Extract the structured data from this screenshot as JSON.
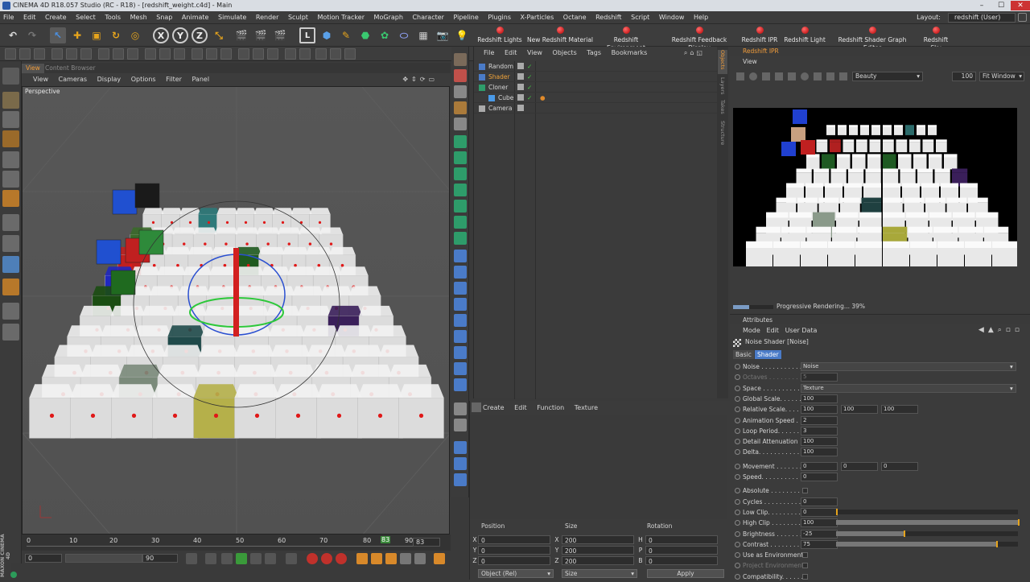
{
  "window": {
    "title": "CINEMA 4D R18.057 Studio (RC - R18) - [redshift_weight.c4d] - Main"
  },
  "menu": [
    "File",
    "Edit",
    "Create",
    "Select",
    "Tools",
    "Mesh",
    "Snap",
    "Animate",
    "Simulate",
    "Render",
    "Sculpt",
    "Motion Tracker",
    "MoGraph",
    "Character",
    "Pipeline",
    "Plugins",
    "X-Particles",
    "Octane",
    "Redshift",
    "Script",
    "Window",
    "Help"
  ],
  "layout": {
    "label": "Layout:",
    "value": "redshift (User)"
  },
  "toolbar": {
    "x_label": "X",
    "y_label": "Y",
    "z_label": "Z"
  },
  "redshift_toolbar": [
    "Redshift Lights",
    "New Redshift Material",
    "Redshift Environment",
    "Redshift Feedback Display",
    "Redshift IPR",
    "Redshift Light",
    "Redshift Shader Graph Editor",
    "Redshift Sky"
  ],
  "viewport": {
    "tabs": [
      "View",
      "Content Browser"
    ],
    "menu": [
      "View",
      "Cameras",
      "Display",
      "Options",
      "Filter",
      "Panel"
    ],
    "label": "Perspective"
  },
  "timeline": {
    "ticks": [
      "0",
      "10",
      "20",
      "30",
      "40",
      "50",
      "60",
      "70",
      "80",
      "83",
      "90"
    ],
    "current_frame": "83",
    "start": "0",
    "end": "90"
  },
  "objects": {
    "menu": [
      "File",
      "Edit",
      "View",
      "Objects",
      "Tags",
      "Bookmarks"
    ],
    "items": [
      {
        "name": "Random",
        "color": "#d6d6d6",
        "indent": 0
      },
      {
        "name": "Shader",
        "color": "#f0a33a",
        "indent": 0
      },
      {
        "name": "Cloner",
        "color": "#d6d6d6",
        "indent": 0
      },
      {
        "name": "Cube",
        "color": "#d6d6d6",
        "indent": 1
      },
      {
        "name": "Camera",
        "color": "#d6d6d6",
        "indent": 0
      }
    ]
  },
  "side_tabs": [
    "Objects",
    "Layers",
    "Takes",
    "Structure"
  ],
  "ipr": {
    "title": "Redshift IPR",
    "view": "View",
    "aov": "Beauty",
    "zoom": "100",
    "fit": "Fit Window",
    "progress_text": "Progressive Rendering... 39%",
    "progress": 0.39
  },
  "attributes": {
    "title": "Attributes",
    "menu": [
      "Mode",
      "Edit",
      "User Data"
    ],
    "object": "Noise Shader [Noise]",
    "tabs": [
      "Basic",
      "Shader"
    ],
    "rows": [
      {
        "label": "Noise . . . . . . . . . . . . .",
        "value": "Noise",
        "wide": true
      },
      {
        "label": "Octaves . . . . . . . . . . .",
        "value": "5",
        "dim": true
      },
      {
        "label": "Space . . . . . . . . . . . . .",
        "value": "Texture",
        "wide": true
      },
      {
        "label": "Global Scale. . . . . . .",
        "value": "100"
      },
      {
        "label": "Relative Scale. . . . . .",
        "value": "100",
        "v2": "100",
        "v3": "100"
      },
      {
        "label": "Animation Speed . .",
        "value": "2"
      },
      {
        "label": "Loop Period. . . . . . .",
        "value": "3"
      },
      {
        "label": "Detail Attenuation",
        "value": "100"
      },
      {
        "label": "Delta. . . . . . . . . . . . . .",
        "value": "100"
      },
      {
        "label": "",
        "value": ""
      },
      {
        "label": "Movement . . . . . . . .",
        "value": "0",
        "v2": "0",
        "v3": "0"
      },
      {
        "label": "Speed. . . . . . . . . . . . .",
        "value": "0"
      },
      {
        "label": "",
        "value": ""
      },
      {
        "label": "Absolute . . . . . . . . . .",
        "value": "",
        "check": true
      },
      {
        "label": "Cycles . . . . . . . . . . . .",
        "value": "0"
      },
      {
        "label": "Low Clip. . . . . . . . . . .",
        "value": "0",
        "slider": 0.0
      },
      {
        "label": "High Clip . . . . . . . . . .",
        "value": "100",
        "slider": 1.0
      },
      {
        "label": "Brightness . . . . . . . .",
        "value": "-25",
        "slider": 0.37
      },
      {
        "label": "Contrast . . . . . . . . . .",
        "value": "75",
        "slider": 0.88
      },
      {
        "label": "Use as Environment",
        "value": "",
        "check": true
      },
      {
        "label": "Project Environment",
        "value": "",
        "check": true,
        "dim": true
      },
      {
        "label": "Compatibility. . . . . . .",
        "value": "",
        "check": true
      }
    ]
  },
  "coords": {
    "menu": [
      "Create",
      "Edit",
      "Function",
      "Texture"
    ],
    "headers": [
      "Position",
      "Size",
      "Rotation"
    ],
    "rows": [
      {
        "a": "X",
        "p": "0",
        "b": "X",
        "s": "200",
        "c": "H",
        "r": "0"
      },
      {
        "a": "Y",
        "p": "0",
        "b": "Y",
        "s": "200",
        "c": "P",
        "r": "0"
      },
      {
        "a": "Z",
        "p": "0",
        "b": "Z",
        "s": "200",
        "c": "B",
        "r": "0"
      }
    ],
    "mode": "Object (Rel)",
    "size_mode": "Size",
    "apply": "Apply"
  },
  "colors": {
    "accent": "#f19c3a",
    "selected": "#4a7bc8",
    "red": "#d22020"
  }
}
